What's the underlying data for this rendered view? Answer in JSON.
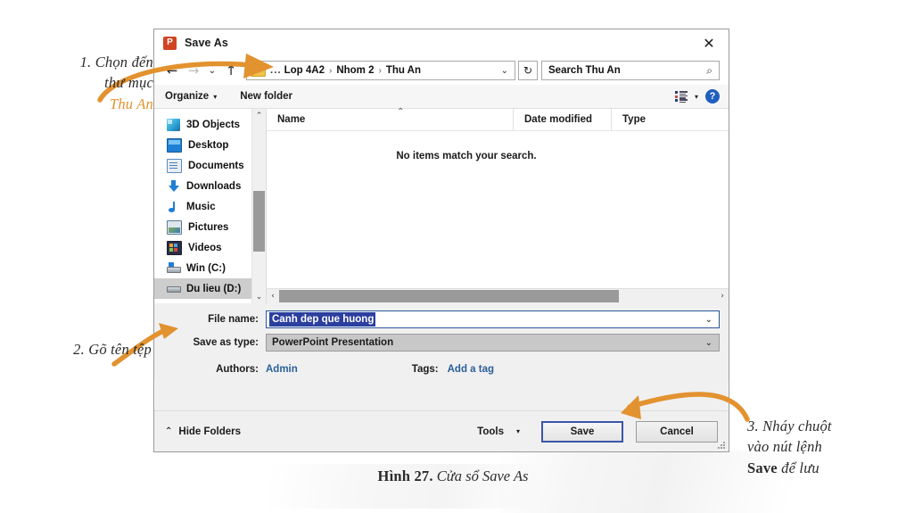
{
  "annotations": {
    "step1_line1": "1. Chọn đến",
    "step1_line2": "thư mục",
    "step1_highlight": "Thu An",
    "step2": "2. Gõ tên tệp",
    "step3_line1": "3. Nháy chuột",
    "step3_line2": "vào nút lệnh",
    "step3_bold": "Save",
    "step3_tail": " để lưu",
    "caption_bold": "Hình 27.",
    "caption_rest": " Cửa sổ Save As",
    "accent_color": "#e2922f"
  },
  "dialog": {
    "title": "Save As",
    "app_icon_letter": "P",
    "close_label": "✕",
    "nav": {
      "back": "←",
      "forward": "→",
      "recent": "⌄",
      "up": "↑",
      "refresh": "↻",
      "address_chevron": "⌄",
      "breadcrumb_lead": "...",
      "breadcrumb": [
        "Lop 4A2",
        "Nhom 2",
        "Thu An"
      ],
      "separator": "›"
    },
    "search": {
      "value": "Search Thu An",
      "placeholder": "Search Thu An",
      "icon": "⌕"
    },
    "toolbar": {
      "organize": "Organize",
      "organize_caret": "▾",
      "new_folder": "New folder",
      "view_caret": "▾",
      "help_label": "?"
    },
    "nav_pane": {
      "items": [
        {
          "label": "3D Objects",
          "icon": "3d-objects-icon",
          "selected": false
        },
        {
          "label": "Desktop",
          "icon": "desktop-icon",
          "selected": false
        },
        {
          "label": "Documents",
          "icon": "documents-icon",
          "selected": false
        },
        {
          "label": "Downloads",
          "icon": "downloads-icon",
          "selected": false
        },
        {
          "label": "Music",
          "icon": "music-icon",
          "selected": false
        },
        {
          "label": "Pictures",
          "icon": "pictures-icon",
          "selected": false
        },
        {
          "label": "Videos",
          "icon": "videos-icon",
          "selected": false
        },
        {
          "label": "Win (C:)",
          "icon": "drive-c-icon",
          "selected": false
        },
        {
          "label": "Du lieu (D:)",
          "icon": "drive-d-icon",
          "selected": true
        }
      ],
      "scroll_up": "⌃",
      "scroll_down": "⌄"
    },
    "file_list": {
      "columns": [
        "Name",
        "Date modified",
        "Type"
      ],
      "sort_indicator": "⌃",
      "empty_message": "No items match your search.",
      "rows": [],
      "hscroll_left": "‹",
      "hscroll_right": "›"
    },
    "form": {
      "file_name_label": "File name:",
      "file_name_value": "Canh dep que huong",
      "file_name_chevron": "⌄",
      "save_as_type_label": "Save as type:",
      "save_as_type_value": "PowerPoint Presentation",
      "save_as_type_chevron": "⌄",
      "authors_label": "Authors:",
      "authors_value": "Admin",
      "tags_label": "Tags:",
      "tags_value": "Add a tag"
    },
    "footer": {
      "hide_folders": "Hide Folders",
      "hide_folders_chevron": "⌃",
      "tools": "Tools",
      "tools_caret": "▾",
      "save": "Save",
      "cancel": "Cancel"
    }
  }
}
